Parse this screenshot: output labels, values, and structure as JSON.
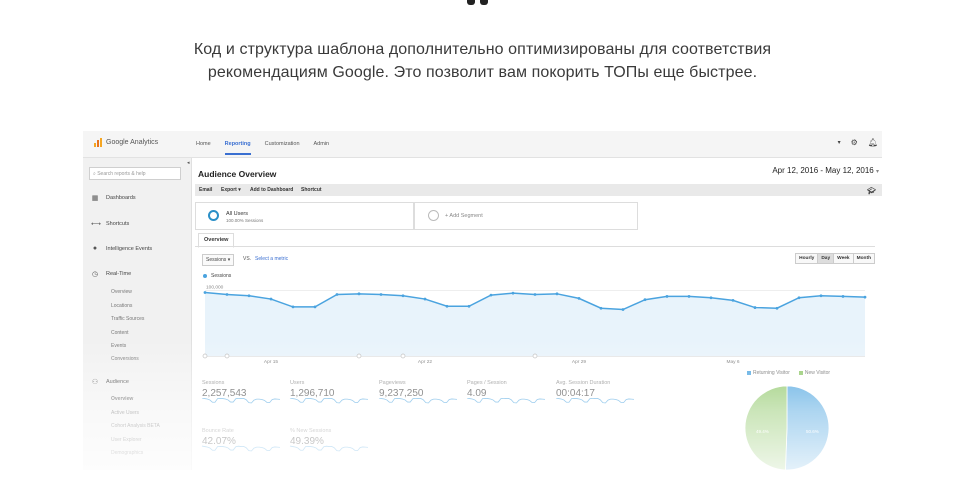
{
  "intro": {
    "line1": "Код и структура шаблона дополнительно оптимизированы для соответствия",
    "line2": "рекомендациям Google. Это позволит вам покорить ТОПы еще быстрее."
  },
  "app": {
    "logo_text": "Google Analytics",
    "nav": [
      "Home",
      "Reporting",
      "Customization",
      "Admin"
    ],
    "active_nav": "Reporting"
  },
  "sidebar": {
    "search_placeholder": "Search reports & help",
    "items": [
      {
        "label": "Dashboards",
        "icon": "grid-icon"
      },
      {
        "label": "Shortcuts",
        "icon": "arrows-icon"
      },
      {
        "label": "Intelligence Events",
        "icon": "lightbulb-icon"
      },
      {
        "label": "Real-Time",
        "icon": "clock-icon"
      }
    ],
    "realtime_sub": [
      "Overview",
      "Locations",
      "Traffic Sources",
      "Content",
      "Events",
      "Conversions"
    ],
    "audience": {
      "label": "Audience",
      "icon": "people-icon"
    },
    "audience_sub": [
      "Overview",
      "Active Users",
      "Cohort Analysis BETA",
      "User Explorer",
      "Demographics"
    ]
  },
  "report": {
    "title": "Audience Overview",
    "date_range": "Apr 12, 2016 - May 12, 2016",
    "toolbar": [
      "Email",
      "Export ▾",
      "Add to Dashboard",
      "Shortcut"
    ],
    "segment_name": "All Users",
    "segment_sub": "100.00% Sessions",
    "add_segment": "+ Add Segment",
    "tab": "Overview",
    "metric": "Sessions",
    "vs": "VS.",
    "select_metric": "Select a metric",
    "granularity": [
      "Hourly",
      "Day",
      "Week",
      "Month"
    ],
    "granularity_active": "Day",
    "legend": "Sessions"
  },
  "chart_data": {
    "type": "area",
    "series": [
      {
        "name": "Sessions",
        "values": [
          97000,
          94000,
          92000,
          87000,
          75000,
          75000,
          94000,
          95000,
          94000,
          92000,
          87000,
          76000,
          76000,
          93000,
          96000,
          94000,
          95000,
          88000,
          73000,
          71000,
          86000,
          91000,
          91000,
          89000,
          85000,
          74000,
          73000,
          89000,
          92000,
          91000,
          90000
        ]
      }
    ],
    "x_tick_labels": [
      "Apr 15",
      "Apr 22",
      "Apr 29",
      "May 6"
    ],
    "y_tick_labels": [
      "100,000",
      "50,000"
    ],
    "ylim": [
      0,
      110000
    ],
    "color": "#4aa3df"
  },
  "stats": [
    {
      "label": "Sessions",
      "value": "2,257,543"
    },
    {
      "label": "Users",
      "value": "1,296,710"
    },
    {
      "label": "Pageviews",
      "value": "9,237,250"
    },
    {
      "label": "Pages / Session",
      "value": "4.09"
    },
    {
      "label": "Avg. Session Duration",
      "value": "00:04:17"
    },
    {
      "label": "Bounce Rate",
      "value": "42.07%"
    },
    {
      "label": "% New Sessions",
      "value": "49.39%"
    }
  ],
  "pie": {
    "legend": [
      {
        "label": "Returning Visitor",
        "color": "#4aa3df"
      },
      {
        "label": "New Visitor",
        "color": "#8cc665"
      }
    ],
    "returning_share": 0.506,
    "slice_labels": [
      "49.4%",
      "50.6%"
    ]
  }
}
